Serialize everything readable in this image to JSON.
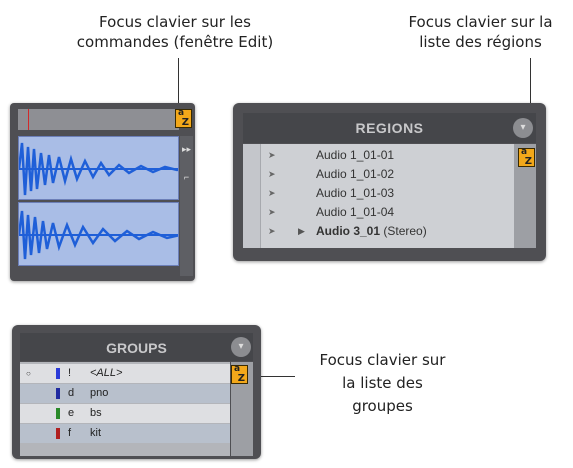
{
  "callouts": {
    "edit_focus": {
      "line1": "Focus clavier sur les",
      "line2": "commandes (fenêtre Edit)"
    },
    "regions_focus": {
      "line1": "Focus clavier sur la",
      "line2": "liste des régions"
    },
    "groups_focus": {
      "line1": "Focus clavier sur",
      "line2": "la liste des",
      "line3": "groupes"
    }
  },
  "regions": {
    "title": "REGIONS",
    "items": [
      {
        "name": "Audio 1_01-01"
      },
      {
        "name": "Audio 1_01-02"
      },
      {
        "name": "Audio 1_01-03"
      },
      {
        "name": "Audio 1_01-04"
      },
      {
        "name": "Audio 3_01",
        "suffix": "(Stereo)"
      }
    ]
  },
  "groups": {
    "title": "GROUPS",
    "items": [
      {
        "letter": "!",
        "name": "<ALL>",
        "color": "#2b3bd8"
      },
      {
        "letter": "d",
        "name": "pno",
        "color": "#1f2aa0"
      },
      {
        "letter": "e",
        "name": "bs",
        "color": "#2a8a2a"
      },
      {
        "letter": "f",
        "name": "kit",
        "color": "#b02020"
      }
    ]
  },
  "colors": {
    "focus_indicator": "#f3a81a",
    "waveform": "#1f5fd8"
  }
}
